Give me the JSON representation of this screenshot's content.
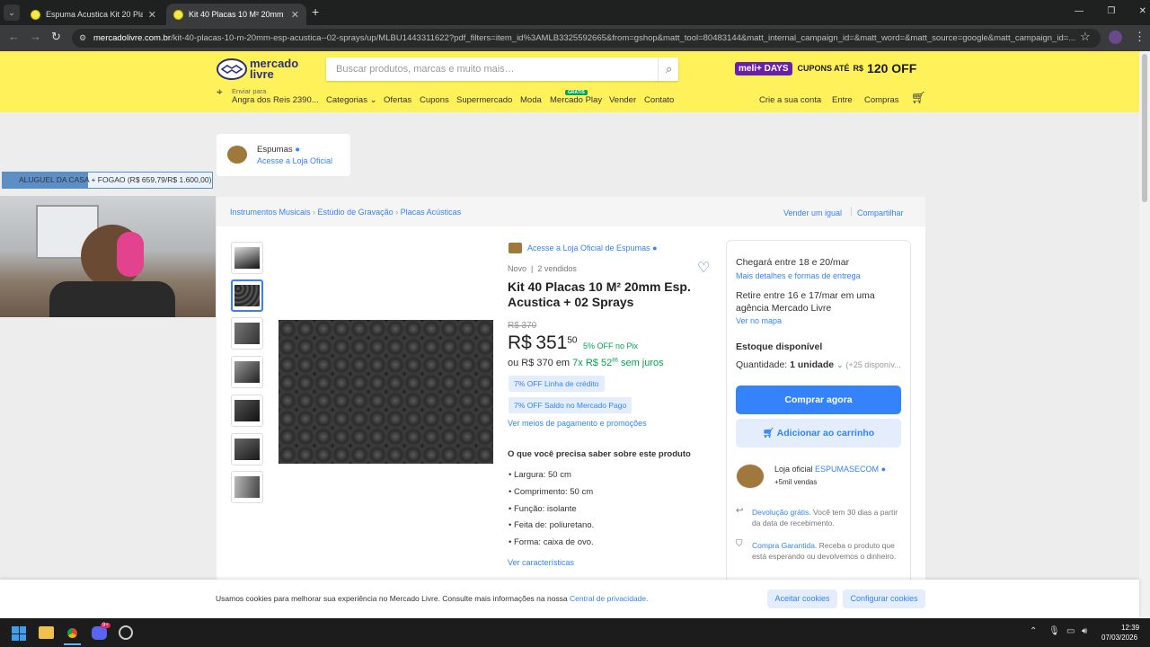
{
  "browser": {
    "tabs": [
      {
        "label": "Espuma Acustica Kit 20 Placas 5"
      },
      {
        "label": "Kit 40 Placas 10 M² 20mm Esp."
      }
    ],
    "new_tab": "+",
    "url_domain": "mercadolivre.com.br",
    "url_path": "/kit-40-placas-10-m-20mm-esp-acustica--02-sprays/up/MLBU1443311622?pdf_filters=item_id%3AMLB3325592665&from=gshop&matt_tool=80483144&matt_internal_campaign_id=&matt_word=&matt_source=google&matt_campaign_id=..."
  },
  "header": {
    "logo_line1": "mercado",
    "logo_line2": "livre",
    "search_placeholder": "Buscar produtos, marcas e muito mais…",
    "promo_brand": "meli+",
    "promo_days": "DAYS",
    "promo_text": "CUPONS ATÉ",
    "promo_currency": "R$",
    "promo_value": "120 OFF",
    "ship_label": "Enviar para",
    "ship_location": "Angra dos Reis 2390...",
    "nav": [
      "Categorias",
      "Ofertas",
      "Cupons",
      "Supermercado",
      "Moda",
      "Mercado Play",
      "Vender",
      "Contato"
    ],
    "nav_badge": "GRÁTIS",
    "account": [
      "Crie a sua conta",
      "Entre",
      "Compras"
    ]
  },
  "store_card": {
    "name": "Espumas",
    "link": "Acesse a Loja Oficial"
  },
  "overlay": {
    "caption": "ALUGUEL DA CASA + FOGAO (R$ 659,79/R$ 1.600,00)"
  },
  "breadcrumb": {
    "items": [
      "Instrumentos Musicais",
      "Estúdio de Gravação",
      "Placas Acústicas"
    ],
    "actions": [
      "Vender um igual",
      "Compartilhar"
    ]
  },
  "product": {
    "store_link": "Acesse a Loja Oficial de Espumas",
    "condition": "Novo",
    "sold": "2 vendidos",
    "title": "Kit 40 Placas 10 M² 20mm Esp. Acustica + 02 Sprays",
    "old_price": "R$ 370",
    "currency": "R$",
    "price_int": "351",
    "price_cents": "50",
    "discount": "5% OFF no Pix",
    "installments_prefix": "ou R$ 370 em",
    "installments": "7x R$ 52",
    "installments_cents": "86",
    "installments_suffix": "sem juros",
    "badges": [
      "7% OFF Linha de crédito",
      "7% OFF Saldo no Mercado Pago"
    ],
    "payment_link": "Ver meios de pagamento e promoções",
    "features_title": "O que você precisa saber sobre este produto",
    "features": [
      "Largura: 50 cm",
      "Comprimento: 50 cm",
      "Função: isolante",
      "Feita de: poliuretano.",
      "Forma: caixa de ovo."
    ],
    "features_link": "Ver características"
  },
  "buy_box": {
    "delivery": "Chegará entre 18 e 20/mar",
    "delivery_link": "Mais detalhes e formas de entrega",
    "pickup": "Retire entre 16 e 17/mar em uma agência Mercado Livre",
    "pickup_link": "Ver no mapa",
    "stock": "Estoque disponível",
    "qty_label": "Quantidade:",
    "qty_value": "1 unidade",
    "qty_avail": "(+25 disponív...",
    "buy_now": "Comprar agora",
    "add_cart": "Adicionar ao carrinho",
    "seller_prefix": "Loja oficial",
    "seller_name": "ESPUMASECOM",
    "seller_sales": "+5mil vendas",
    "return_link": "Devolução grátis.",
    "return_text": "Você tem 30 dias a partir da data de recebimento.",
    "guarantee_link": "Compra Garantida.",
    "guarantee_text": "Receba o produto que está esperando ou devolvemos o dinheiro."
  },
  "cookie": {
    "text": "Usamos cookies para melhorar sua experiência no Mercado Livre. Consulte mais informações na nossa",
    "link": "Central de privacidade.",
    "accept": "Aceitar cookies",
    "configure": "Configurar cookies"
  },
  "taskbar": {
    "time": "12:39",
    "date": "07/03/2026",
    "discord_badge": "9+"
  },
  "colors": {
    "brand_yellow": "#fff159",
    "accent_blue": "#3483fa",
    "green": "#00a650"
  }
}
